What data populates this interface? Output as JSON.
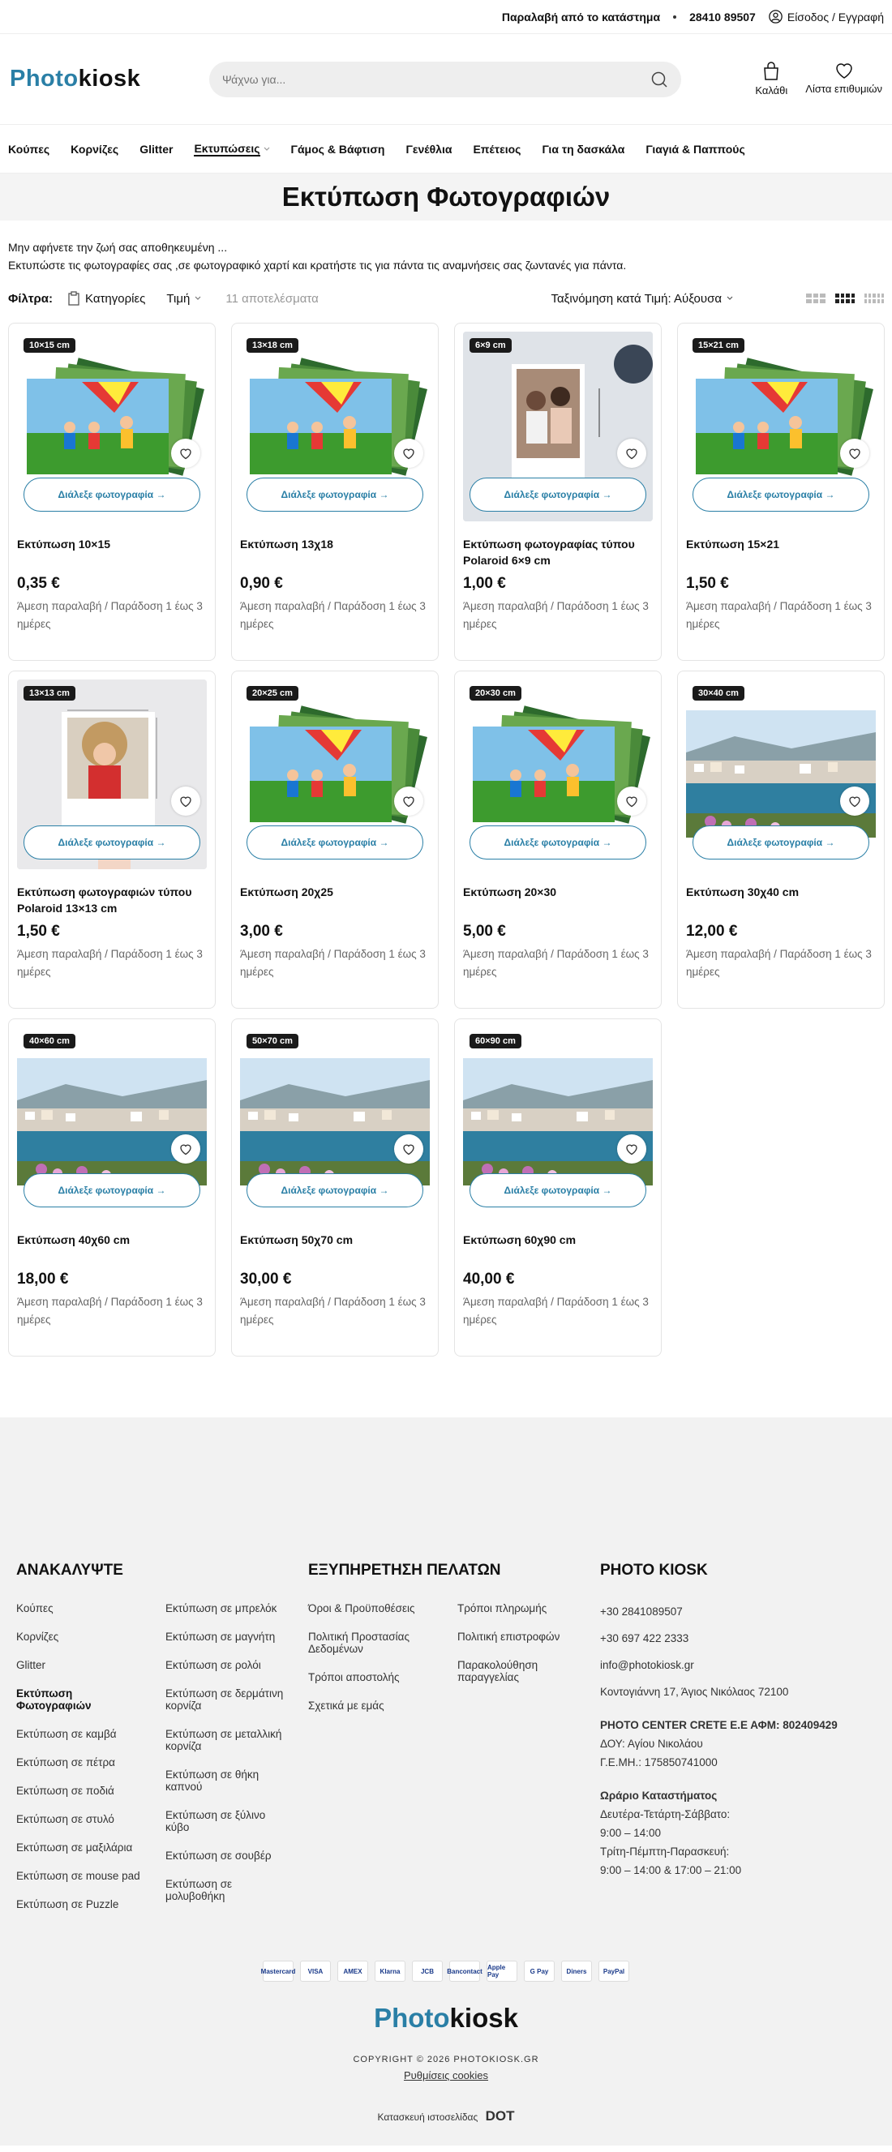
{
  "topbar": {
    "pickup": "Παραλαβή από το κατάστημα",
    "phone": "28410 89507",
    "login": "Είσοδος / Εγγραφή"
  },
  "logo": {
    "part1": "Photo",
    "part2": "kiosk"
  },
  "search": {
    "placeholder": "Ψάχνω για..."
  },
  "header_icons": {
    "cart": "Καλάθι",
    "wishlist": "Λίστα επιθυμιών"
  },
  "nav": [
    "Κούπες",
    "Κορνίζες",
    "Glitter",
    "Εκτυπώσεις",
    "Γάμος & Βάφτιση",
    "Γενέθλια",
    "Επέτειος",
    "Για τη δασκάλα",
    "Γιαγιά & Παππούς"
  ],
  "page_title": "Εκτύπωση Φωτογραφιών",
  "intro": {
    "line1": "Μην αφήνετε την ζωή σας αποθηκευμένη ...",
    "line2": "Εκτυπώστε τις φωτογραφίες σας ,σε φωτογραφικό χαρτί και κρατήστε τις για πάντα τις αναμνήσεις σας ζωντανές για πάντα."
  },
  "filters": {
    "label": "Φίλτρα:",
    "categories": "Κατηγορίες",
    "price": "Τιμή",
    "count": "11 αποτελέσματα",
    "sort": "Ταξινόμηση κατά Τιμή: Αύξουσα"
  },
  "choose_label": "Διάλεξε φωτογραφία →",
  "delivery": "Άμεση παραλαβή / Παράδοση 1 έως 3 ημέρες",
  "products": [
    {
      "badge": "10×15 cm",
      "name": "Εκτύπωση 10×15",
      "price": "0,35 €",
      "img": "stack"
    },
    {
      "badge": "13×18 cm",
      "name": "Εκτύπωση 13χ18",
      "price": "0,90 €",
      "img": "stack"
    },
    {
      "badge": "6×9 cm",
      "name": "Εκτύπωση φωτογραφίας τύπου Polaroid 6×9 cm",
      "price": "1,00 €",
      "img": "polaroid",
      "dim": "9 cm"
    },
    {
      "badge": "15×21 cm",
      "name": "Εκτύπωση 15×21",
      "price": "1,50 €",
      "img": "stack"
    },
    {
      "badge": "13×13 cm",
      "name": "Εκτύπωση φωτογραφιών τύπου Polaroid 13×13 cm",
      "price": "1,50 €",
      "img": "polaroid2",
      "dim": "13"
    },
    {
      "badge": "20×25 cm",
      "name": "Εκτύπωση 20χ25",
      "price": "3,00 €",
      "img": "stack"
    },
    {
      "badge": "20×30 cm",
      "name": "Εκτύπωση 20×30",
      "price": "5,00 €",
      "img": "stack"
    },
    {
      "badge": "30×40 cm",
      "name": "Εκτύπωση 30χ40 cm",
      "price": "12,00 €",
      "img": "harbor"
    },
    {
      "badge": "40×60 cm",
      "name": "Εκτύπωση 40χ60 cm",
      "price": "18,00 €",
      "img": "harbor"
    },
    {
      "badge": "50×70 cm",
      "name": "Εκτύπωση 50χ70 cm",
      "price": "30,00 €",
      "img": "harbor"
    },
    {
      "badge": "60×90 cm",
      "name": "Εκτύπωση 60χ90 cm",
      "price": "40,00 €",
      "img": "harbor"
    }
  ],
  "footer": {
    "discover_title": "ΑΝΑΚΑΛΥΨΤΕ",
    "discover_col1": [
      "Κούπες",
      "Κορνίζες",
      "Glitter",
      "Εκτύπωση Φωτογραφιών",
      "Εκτύπωση σε καμβά",
      "Εκτύπωση σε πέτρα",
      "Εκτύπωση σε ποδιά",
      "Εκτύπωση σε στυλό",
      "Εκτύπωση σε μαξιλάρια",
      "Εκτύπωση σε mouse pad",
      "Εκτύπωση σε Puzzle"
    ],
    "discover_col2": [
      "Εκτύπωση σε μπρελόκ",
      "Εκτύπωση σε μαγνήτη",
      "Εκτύπωση σε ρολόι",
      "Εκτύπωση σε δερμάτινη κορνίζα",
      "Εκτύπωση σε μεταλλική κορνίζα",
      "Εκτύπωση σε θήκη καπνού",
      "Εκτύπωση σε ξύλινο κύβο",
      "Εκτύπωση σε σουβέρ",
      "Εκτύπωση σε μολυβοθήκη"
    ],
    "service_title": "ΕΞΥΠΗΡΕΤΗΣΗ ΠΕΛΑΤΩΝ",
    "service_col1": [
      "Όροι & Προϋποθέσεις",
      "Πολιτική Προστασίας Δεδομένων",
      "Τρόποι αποστολής",
      "Σχετικά με εμάς"
    ],
    "service_col2": [
      "Τρόποι πληρωμής",
      "Πολιτική επιστροφών",
      "Παρακολούθηση παραγγελίας"
    ],
    "kiosk_title": "PHOTO KIOSK",
    "phone1": "+30 2841089507",
    "phone2": "+30 697 422 2333",
    "email": "info@photokiosk.gr",
    "address": "Κοντογιάννη 17, Άγιος Νικόλαος 72100",
    "company": "PHOTO CENTER CRETE Ε.Ε ΑΦΜ: 802409429",
    "doy": "ΔΟΥ: Αγίου Νικολάου",
    "gemi": "Γ.Ε.ΜΗ.: 175850741000",
    "hours_title": "Ωράριο Καταστήματος",
    "hours1": "Δευτέρα-Τετάρτη-Σάββατο:",
    "hours1_time": "9:00 – 14:00",
    "hours2": "Τρίτη-Πέμπτη-Παρασκευή:",
    "hours2_time": "9:00 – 14:00 & 17:00 – 21:00",
    "payments": [
      "Mastercard",
      "VISA",
      "AMEX",
      "Klarna",
      "JCB",
      "Bancontact",
      "Apple Pay",
      "G Pay",
      "Diners",
      "PayPal"
    ],
    "copyright": "COPYRIGHT © 2026 PHOTOKIOSK.GR",
    "cookies": "Ρυθμίσεις cookies",
    "made_by": "Κατασκευή ιστοσελίδας",
    "made_by_logo": "DOT"
  }
}
